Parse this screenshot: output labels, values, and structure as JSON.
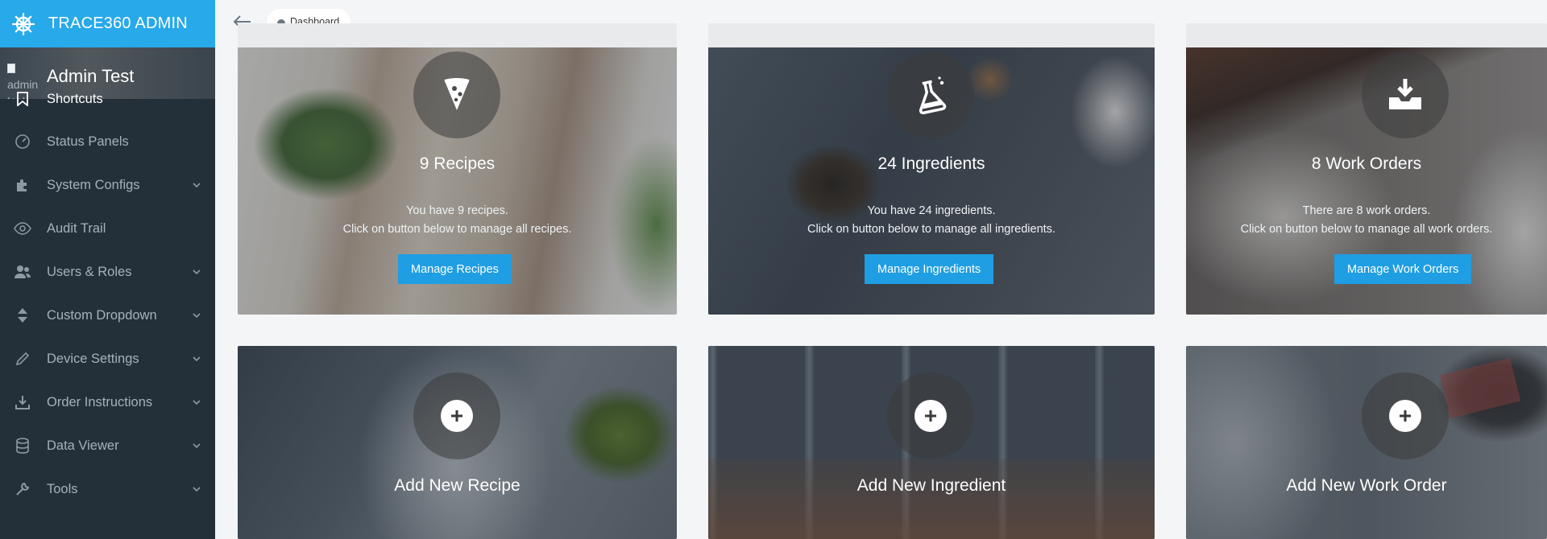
{
  "app": {
    "brand": "TRACE360 ADMIN"
  },
  "user": {
    "name": "Admin Test",
    "avatar_alt": "admin test avatar"
  },
  "sidebar": {
    "items": [
      {
        "label": "Shortcuts",
        "icon": "bookmark-icon",
        "expandable": false,
        "active": true
      },
      {
        "label": "Status Panels",
        "icon": "dashboard-gauge-icon",
        "expandable": false
      },
      {
        "label": "System Configs",
        "icon": "puzzle-icon",
        "expandable": true
      },
      {
        "label": "Audit Trail",
        "icon": "eye-icon",
        "expandable": false
      },
      {
        "label": "Users & Roles",
        "icon": "users-icon",
        "expandable": true
      },
      {
        "label": "Custom Dropdown",
        "icon": "sort-icon",
        "expandable": true
      },
      {
        "label": "Device Settings",
        "icon": "pencil-icon",
        "expandable": true
      },
      {
        "label": "Order Instructions",
        "icon": "download-icon",
        "expandable": true
      },
      {
        "label": "Data Viewer",
        "icon": "database-icon",
        "expandable": true
      },
      {
        "label": "Tools",
        "icon": "wrench-icon",
        "expandable": true
      }
    ]
  },
  "header": {
    "breadcrumb": "Dashboard",
    "breadcrumb_icon": "dashboard-icon",
    "back_icon": "arrow-left-icon"
  },
  "cards": [
    {
      "title": "9 Recipes",
      "line1": "You have 9 recipes.",
      "line2": "Click on button below to manage all recipes.",
      "button": "Manage Recipes",
      "icon": "pizza-slice-icon"
    },
    {
      "title": "24 Ingredients",
      "line1": "You have 24 ingredients.",
      "line2": "Click on button below to manage all ingredients.",
      "button": "Manage Ingredients",
      "icon": "flask-icon"
    },
    {
      "title": "8 Work Orders",
      "line1": "There are 8 work orders.",
      "line2": "Click on button below to manage all work orders.",
      "button": "Manage Work Orders",
      "icon": "inbox-download-icon"
    }
  ],
  "add_cards": [
    {
      "title": "Add New Recipe",
      "icon": "plus-circle-icon"
    },
    {
      "title": "Add New Ingredient",
      "icon": "plus-circle-icon"
    },
    {
      "title": "Add New Work Order",
      "icon": "plus-circle-icon"
    }
  ],
  "colors": {
    "brand": "#27a9ea",
    "sidebar": "#243039",
    "button": "#1f9ee3"
  }
}
